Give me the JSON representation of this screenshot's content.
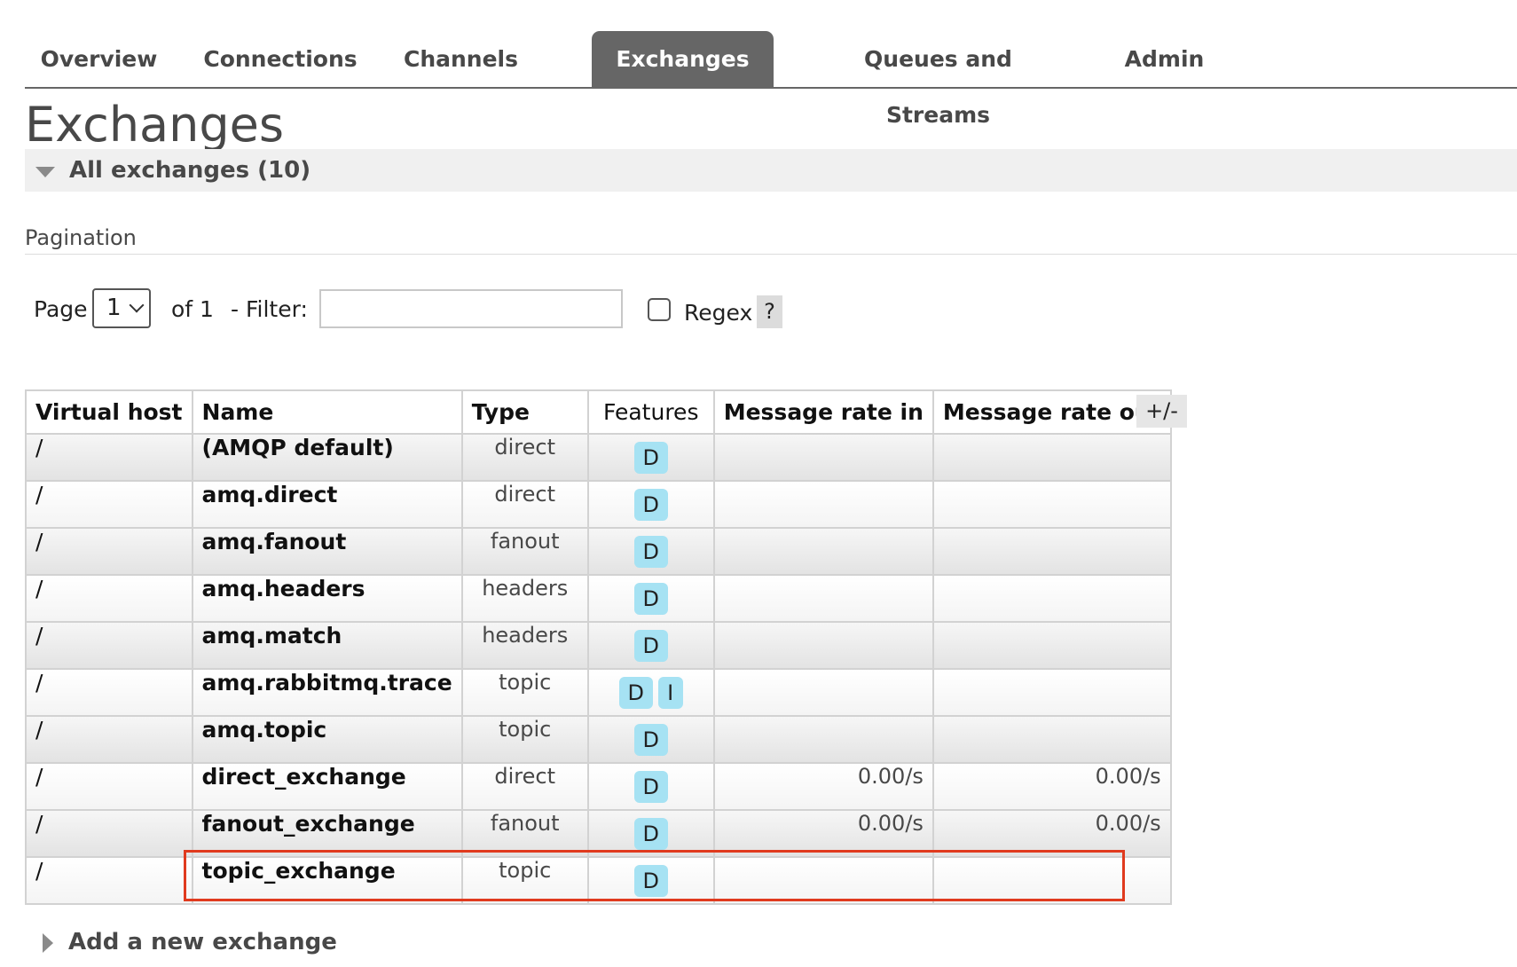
{
  "nav": {
    "tabs": [
      {
        "label": "Overview",
        "active": false
      },
      {
        "label": "Connections",
        "active": false
      },
      {
        "label": "Channels",
        "active": false
      },
      {
        "label": "Exchanges",
        "active": true
      },
      {
        "label": "Queues and Streams",
        "active": false
      },
      {
        "label": "Admin",
        "active": false
      }
    ]
  },
  "page": {
    "title": "Exchanges"
  },
  "section": {
    "label": "All exchanges (10)"
  },
  "pagination": {
    "heading": "Pagination",
    "page_label": "Page",
    "page_value": "1",
    "of_label": "of 1",
    "filter_label": "- Filter:",
    "filter_value": "",
    "regex_label": "Regex",
    "regex_checked": false,
    "help_label": "?"
  },
  "table": {
    "columns_toggle": "+/-",
    "headers": [
      "Virtual host",
      "Name",
      "Type",
      "Features",
      "Message rate in",
      "Message rate out"
    ],
    "rows": [
      {
        "vhost": "/",
        "name": "(AMQP default)",
        "type": "direct",
        "features": [
          "D"
        ],
        "rate_in": "",
        "rate_out": ""
      },
      {
        "vhost": "/",
        "name": "amq.direct",
        "type": "direct",
        "features": [
          "D"
        ],
        "rate_in": "",
        "rate_out": ""
      },
      {
        "vhost": "/",
        "name": "amq.fanout",
        "type": "fanout",
        "features": [
          "D"
        ],
        "rate_in": "",
        "rate_out": ""
      },
      {
        "vhost": "/",
        "name": "amq.headers",
        "type": "headers",
        "features": [
          "D"
        ],
        "rate_in": "",
        "rate_out": ""
      },
      {
        "vhost": "/",
        "name": "amq.match",
        "type": "headers",
        "features": [
          "D"
        ],
        "rate_in": "",
        "rate_out": ""
      },
      {
        "vhost": "/",
        "name": "amq.rabbitmq.trace",
        "type": "topic",
        "features": [
          "D",
          "I"
        ],
        "rate_in": "",
        "rate_out": ""
      },
      {
        "vhost": "/",
        "name": "amq.topic",
        "type": "topic",
        "features": [
          "D"
        ],
        "rate_in": "",
        "rate_out": ""
      },
      {
        "vhost": "/",
        "name": "direct_exchange",
        "type": "direct",
        "features": [
          "D"
        ],
        "rate_in": "0.00/s",
        "rate_out": "0.00/s"
      },
      {
        "vhost": "/",
        "name": "fanout_exchange",
        "type": "fanout",
        "features": [
          "D"
        ],
        "rate_in": "0.00/s",
        "rate_out": "0.00/s"
      },
      {
        "vhost": "/",
        "name": "topic_exchange",
        "type": "topic",
        "features": [
          "D"
        ],
        "rate_in": "",
        "rate_out": "",
        "highlighted": true
      }
    ]
  },
  "add_section": {
    "label": "Add a new exchange"
  },
  "colors": {
    "active_tab": "#666666",
    "badge": "#a6e2f3",
    "highlight": "#e03a1e"
  }
}
